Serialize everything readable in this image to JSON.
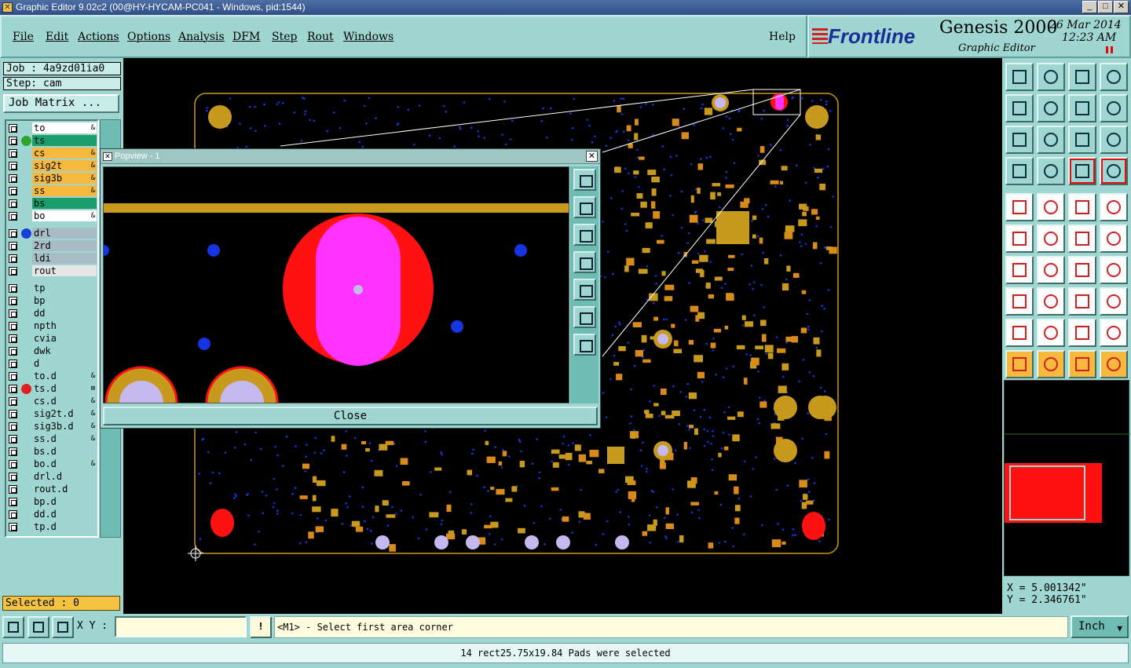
{
  "window": {
    "title": "Graphic Editor 9.02c2 (00@HY-HYCAM-PC041 - Windows, pid:1544)"
  },
  "menu": [
    "File",
    "Edit",
    "Actions",
    "Options",
    "Analysis",
    "DFM",
    "Step",
    "Rout",
    "Windows"
  ],
  "help": "Help",
  "brand": {
    "logo": "Frontline",
    "product": "Genesis 2000",
    "subtitle": "Graphic Editor",
    "date": "26 Mar 2014",
    "time": "12:23 AM"
  },
  "job": {
    "job_label": "Job : 4a9zd01ia0",
    "step_label": "Step: cam",
    "matrix_button": "Job Matrix ..."
  },
  "layers": [
    {
      "name": "to",
      "bg": "#ffffff",
      "dot": "",
      "mark": "&"
    },
    {
      "name": "ts",
      "bg": "#1c9e6c",
      "dot": "#2fa52c",
      "mark": ""
    },
    {
      "name": "cs",
      "bg": "#f7b83e",
      "dot": "",
      "mark": "&"
    },
    {
      "name": "sig2t",
      "bg": "#f7b83e",
      "dot": "",
      "mark": "&"
    },
    {
      "name": "sig3b",
      "bg": "#f7b83e",
      "dot": "",
      "mark": "&"
    },
    {
      "name": "ss",
      "bg": "#f7b83e",
      "dot": "",
      "mark": "&"
    },
    {
      "name": "bs",
      "bg": "#1c9e6c",
      "dot": "",
      "mark": ""
    },
    {
      "name": "bo",
      "bg": "#ffffff",
      "dot": "",
      "mark": "&"
    },
    {
      "name": "drl",
      "bg": "#a7bcc4",
      "dot": "#1a3ed8",
      "mark": ""
    },
    {
      "name": "2rd",
      "bg": "#a7bcc4",
      "dot": "",
      "mark": ""
    },
    {
      "name": "ldi",
      "bg": "#a7bcc4",
      "dot": "",
      "mark": ""
    },
    {
      "name": "rout",
      "bg": "#e6e6e6",
      "dot": "",
      "mark": ""
    },
    {
      "name": "tp",
      "bg": "#9fd6d1",
      "dot": "",
      "mark": ""
    },
    {
      "name": "bp",
      "bg": "#9fd6d1",
      "dot": "",
      "mark": ""
    },
    {
      "name": "dd",
      "bg": "#9fd6d1",
      "dot": "",
      "mark": ""
    },
    {
      "name": "npth",
      "bg": "#9fd6d1",
      "dot": "",
      "mark": ""
    },
    {
      "name": "cvia",
      "bg": "#9fd6d1",
      "dot": "",
      "mark": ""
    },
    {
      "name": "dwk",
      "bg": "#9fd6d1",
      "dot": "",
      "mark": ""
    },
    {
      "name": "d",
      "bg": "#9fd6d1",
      "dot": "",
      "mark": ""
    },
    {
      "name": "to.d",
      "bg": "#9fd6d1",
      "dot": "",
      "mark": "&"
    },
    {
      "name": "ts.d",
      "bg": "#9fd6d1",
      "dot": "#e02020",
      "mark": "⊞"
    },
    {
      "name": "cs.d",
      "bg": "#9fd6d1",
      "dot": "",
      "mark": "&"
    },
    {
      "name": "sig2t.d",
      "bg": "#9fd6d1",
      "dot": "",
      "mark": "&"
    },
    {
      "name": "sig3b.d",
      "bg": "#9fd6d1",
      "dot": "",
      "mark": "&"
    },
    {
      "name": "ss.d",
      "bg": "#9fd6d1",
      "dot": "",
      "mark": "&"
    },
    {
      "name": "bs.d",
      "bg": "#9fd6d1",
      "dot": "",
      "mark": ""
    },
    {
      "name": "bo.d",
      "bg": "#9fd6d1",
      "dot": "",
      "mark": "&"
    },
    {
      "name": "drl.d",
      "bg": "#9fd6d1",
      "dot": "",
      "mark": ""
    },
    {
      "name": "rout.d",
      "bg": "#9fd6d1",
      "dot": "",
      "mark": ""
    },
    {
      "name": "bp.d",
      "bg": "#9fd6d1",
      "dot": "",
      "mark": ""
    },
    {
      "name": "dd.d",
      "bg": "#9fd6d1",
      "dot": "",
      "mark": ""
    },
    {
      "name": "tp.d",
      "bg": "#9fd6d1",
      "dot": "",
      "mark": ""
    }
  ],
  "selected": "Selected : 0",
  "popview": {
    "title": "Popview - 1",
    "close": "Close"
  },
  "coords": {
    "x": "X =  5.001342\"",
    "y": "Y =  2.346761\""
  },
  "bottom": {
    "xy_label": "X Y :",
    "xy_value": "",
    "prompt": "<M1> - Select first area corner",
    "units": "Inch",
    "status": "14 rect25.75x19.84 Pads were selected"
  },
  "colors": {
    "teal_bg": "#9fd6d1",
    "pcb_copper": "#c79a1e",
    "pcb_pad": "#d88a1a",
    "via_blue": "#1535e0",
    "highlight_magenta": "#ff33ff",
    "highlight_red": "#ff1111",
    "drill_lavender": "#c4b8ee"
  }
}
